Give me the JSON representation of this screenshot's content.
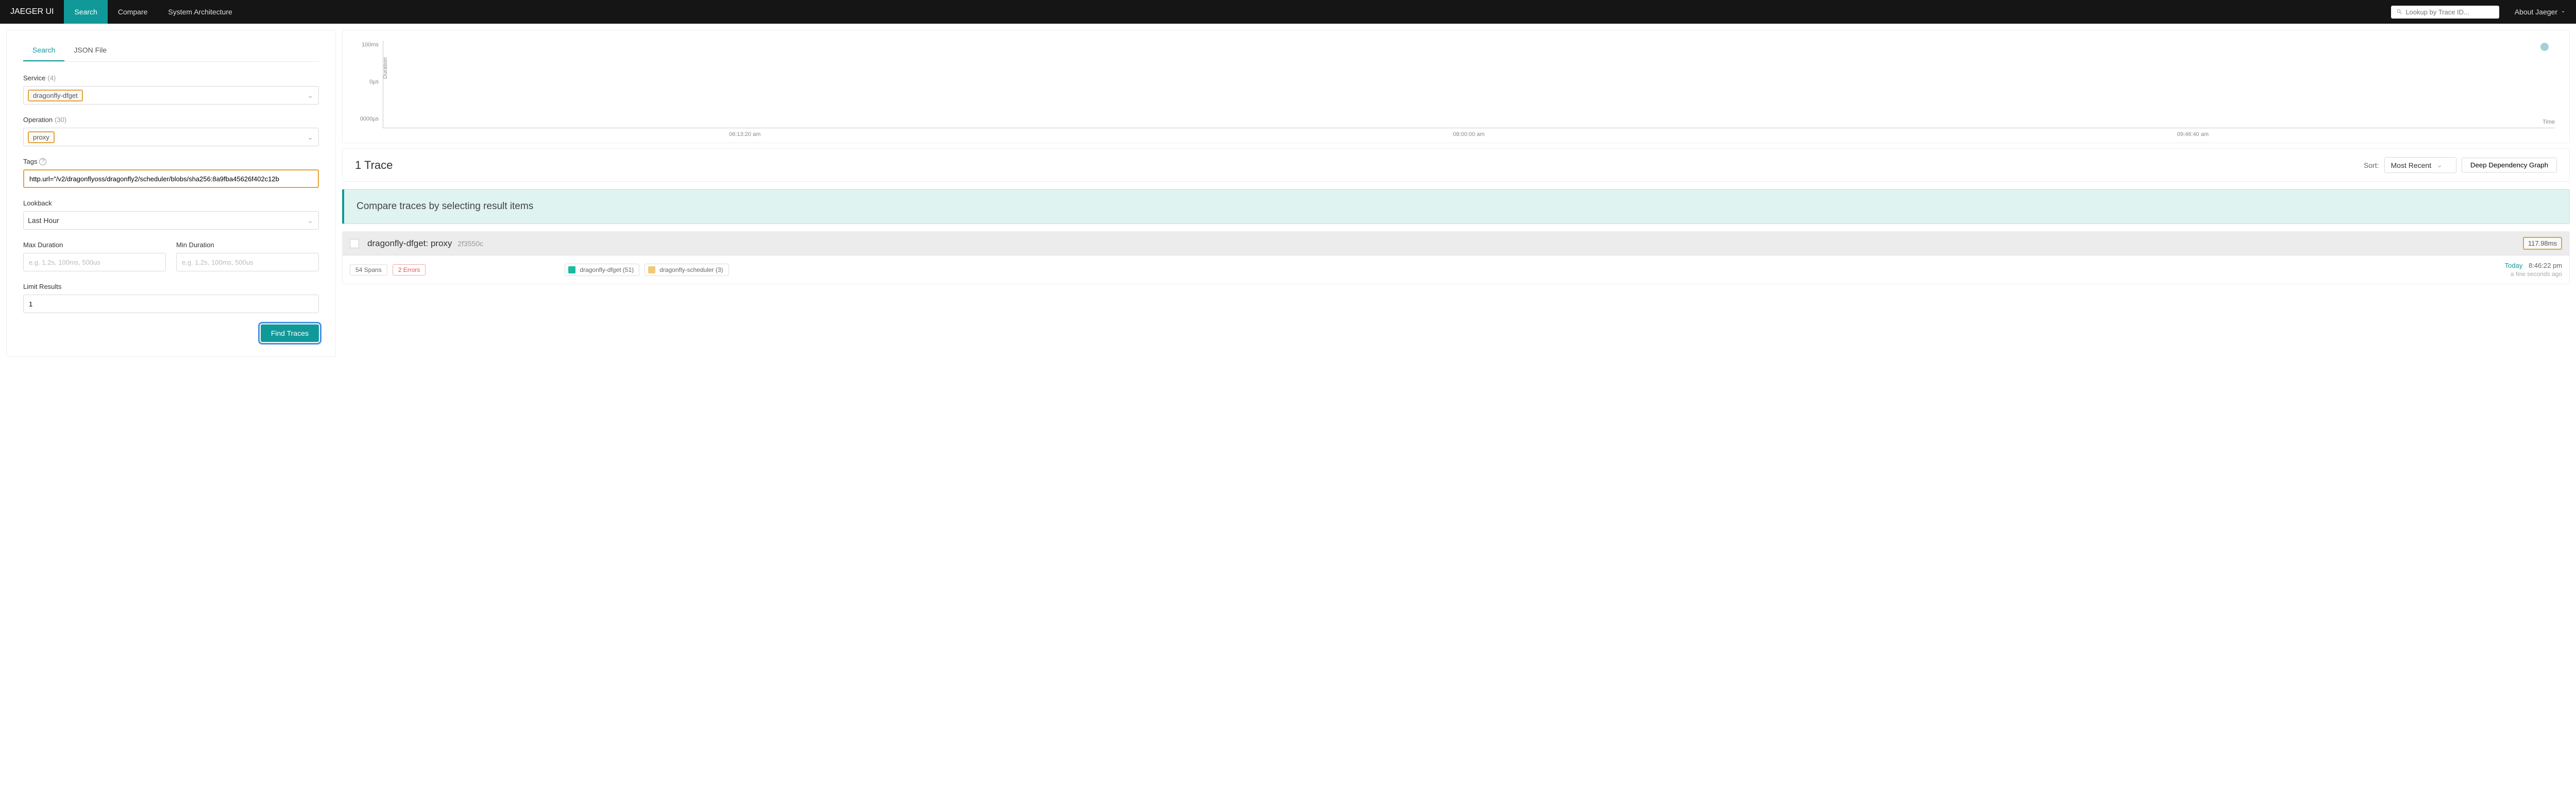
{
  "nav": {
    "brand": "JAEGER UI",
    "links": {
      "search": "Search",
      "compare": "Compare",
      "arch": "System Architecture"
    },
    "lookup_placeholder": "Lookup by Trace ID...",
    "about": "About Jaeger"
  },
  "sidebar": {
    "tabs": {
      "search": "Search",
      "json": "JSON File"
    },
    "service": {
      "label": "Service",
      "count": "(4)",
      "value": "dragonfly-dfget"
    },
    "operation": {
      "label": "Operation",
      "count": "(30)",
      "value": "proxy"
    },
    "tags": {
      "label": "Tags",
      "value": "http.url=\"/v2/dragonflyoss/dragonfly2/scheduler/blobs/sha256:8a9fba45626f402c12b"
    },
    "lookback": {
      "label": "Lookback",
      "value": "Last Hour"
    },
    "max_duration": {
      "label": "Max Duration",
      "placeholder": "e.g. 1.2s, 100ms, 500us"
    },
    "min_duration": {
      "label": "Min Duration",
      "placeholder": "e.g. 1.2s, 100ms, 500us"
    },
    "limit": {
      "label": "Limit Results",
      "value": "1"
    },
    "find_btn": "Find Traces"
  },
  "scatter": {
    "y_ticks": [
      "100ms",
      "0µs",
      "0000µs"
    ],
    "x_ticks": [
      "06:13:20 am",
      "08:00:00 am",
      "09:46:40 am"
    ],
    "y_label": "Duration",
    "x_label": "Time"
  },
  "chart_data": {
    "type": "scatter",
    "title": "",
    "xlabel": "Time",
    "ylabel": "Duration",
    "y_ticks_ms": [
      100,
      0,
      0
    ],
    "x_ticks": [
      "06:13:20 am",
      "08:00:00 am",
      "09:46:40 am"
    ],
    "series": [
      {
        "name": "traces",
        "points": [
          {
            "time": "08:46:22 pm",
            "duration_ms": 117.98
          }
        ]
      }
    ]
  },
  "results": {
    "title": "1 Trace",
    "sort_label": "Sort:",
    "sort_value": "Most Recent",
    "ddg_btn": "Deep Dependency Graph"
  },
  "compare_banner": "Compare traces by selecting result items",
  "trace": {
    "title": "dragonfly-dfget: proxy",
    "id": "2f3550c",
    "duration": "117.98ms",
    "spans": "54 Spans",
    "errors": "2 Errors",
    "services": [
      {
        "name": "dragonfly-dfget (51)",
        "color": "#1abc9c"
      },
      {
        "name": "dragonfly-scheduler (3)",
        "color": "#f1c87a"
      }
    ],
    "meta": {
      "today": "Today",
      "time": "8:46:22 pm",
      "ago": "a few seconds ago"
    }
  }
}
